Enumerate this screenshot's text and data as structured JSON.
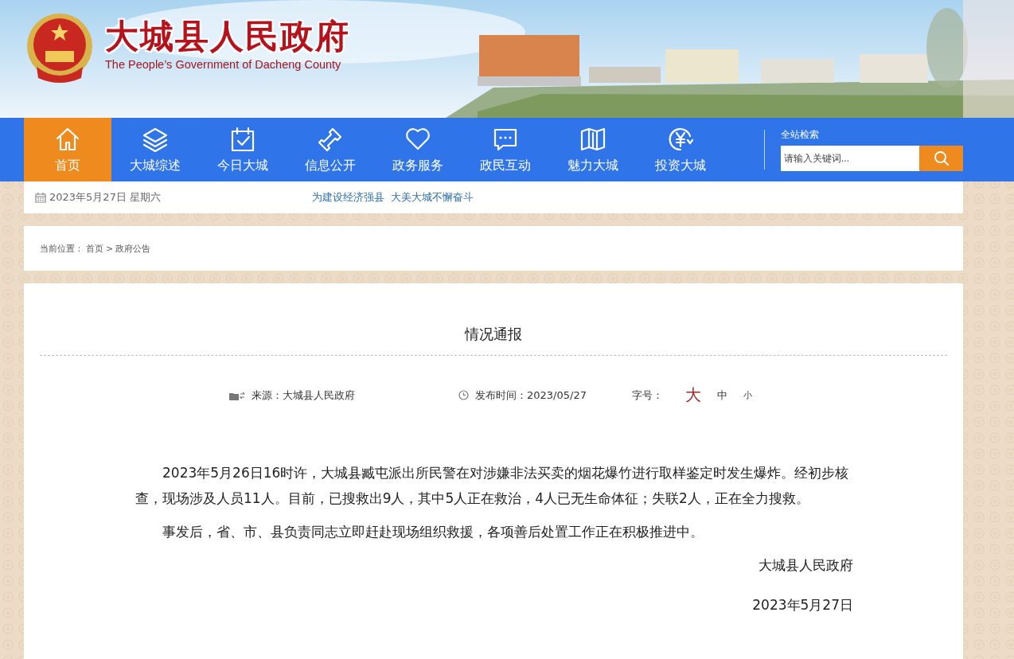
{
  "header": {
    "title": "大城县人民政府",
    "subtitle": "The People’s Government of Dacheng County"
  },
  "nav": {
    "items": [
      {
        "label": "首页",
        "selected": true
      },
      {
        "label": "大城综述",
        "selected": false
      },
      {
        "label": "今日大城",
        "selected": false
      },
      {
        "label": "信息公开",
        "selected": false
      },
      {
        "label": "政务服务",
        "selected": false
      },
      {
        "label": "政民互动",
        "selected": false
      },
      {
        "label": "魅力大城",
        "selected": false
      },
      {
        "label": "投资大城",
        "selected": false
      }
    ],
    "search": {
      "label": "全站检索",
      "placeholder": "请输入关键词..."
    }
  },
  "info_bar": {
    "date": "2023年5月27日 星期六",
    "slogan_1": "为建设经济强县",
    "slogan_2": "大美大城不懈奋斗"
  },
  "breadcrumb": {
    "label": "当前位置：",
    "items": [
      "首页",
      "政府公告"
    ],
    "separator": ">"
  },
  "article": {
    "title": "情况通报",
    "source": "来源：大城县人民政府",
    "published": "发布时间：2023/05/27",
    "font_size_label": "字号：",
    "font_sizes": [
      {
        "label": "大",
        "selected": true
      },
      {
        "label": "中",
        "selected": false
      },
      {
        "label": "小",
        "selected": false
      }
    ],
    "paragraphs": [
      "2023年5月26日16时许，大城县臧屯派出所民警在对涉嫌非法买卖的烟花爆竹进行取样鉴定时发生爆炸。经初步核查，现场涉及人员11人。目前，已搜救出9人，其中5人正在救治，4人已无生命体征；失联2人，正在全力搜救。",
      "事发后，省、市、县负责同志立即赶赴现场组织救援，各项善后处置工作正在积极推进中。"
    ],
    "signature": "大城县人民政府",
    "date": "2023年5月27日"
  }
}
